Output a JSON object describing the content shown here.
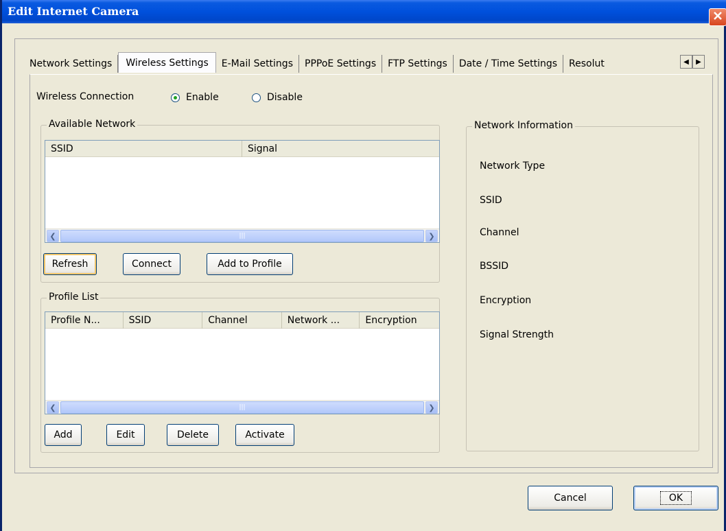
{
  "window": {
    "title": "Edit Internet Camera"
  },
  "tabs": [
    {
      "label": "Network Settings"
    },
    {
      "label": "Wireless Settings"
    },
    {
      "label": "E-Mail Settings"
    },
    {
      "label": "PPPoE Settings"
    },
    {
      "label": "FTP Settings"
    },
    {
      "label": "Date / Time Settings"
    },
    {
      "label": "Resolut"
    }
  ],
  "tab_scroll": {
    "left_icon": "◀",
    "right_icon": "▶"
  },
  "wireless_connection": {
    "label": "Wireless Connection",
    "enable_label": "Enable",
    "disable_label": "Disable",
    "selected": "Enable"
  },
  "available_network": {
    "legend": "Available Network",
    "columns": [
      "SSID",
      "Signal"
    ],
    "rows": [],
    "buttons": {
      "refresh": "Refresh",
      "connect": "Connect",
      "add_to_profile": "Add to Profile"
    }
  },
  "profile_list": {
    "legend": "Profile List",
    "columns": [
      "Profile N...",
      "SSID",
      "Channel",
      "Network ...",
      "Encryption"
    ],
    "rows": [],
    "buttons": {
      "add": "Add",
      "edit": "Edit",
      "delete": "Delete",
      "activate": "Activate"
    }
  },
  "network_information": {
    "legend": "Network Information",
    "fields": [
      "Network Type",
      "SSID",
      "Channel",
      "BSSID",
      "Encryption",
      "Signal Strength"
    ]
  },
  "footer": {
    "cancel": "Cancel",
    "ok": "OK"
  },
  "icons": {
    "close": "close-icon",
    "scroll_left": "chevron-left-icon",
    "scroll_right": "chevron-right-icon"
  },
  "colors": {
    "titlebar": "#0050dc",
    "face": "#ece9d8",
    "close": "#d8451e"
  }
}
